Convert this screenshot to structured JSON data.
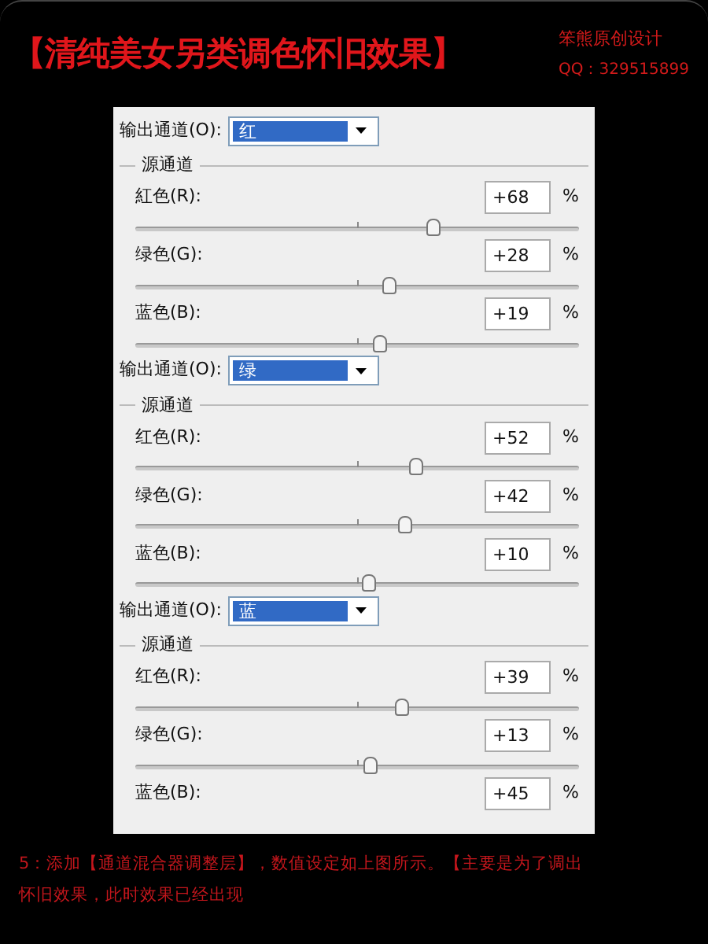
{
  "header": {
    "title": "【清纯美女另类调色怀旧效果】",
    "credit": "笨熊原创设计",
    "qq": "QQ：329515899"
  },
  "sections": [
    {
      "output_label": "输出通道(O):",
      "output_value": "红",
      "group_label": "源通道",
      "channels": [
        {
          "label": "紅色(R):",
          "value": "+68",
          "unit": "%",
          "level": 0.67
        },
        {
          "label": "绿色(G):",
          "value": "+28",
          "unit": "%",
          "level": 0.57
        },
        {
          "label": "蓝色(B):",
          "value": "+19",
          "unit": "%",
          "level": 0.55
        }
      ]
    },
    {
      "output_label": "输出通道(O):",
      "output_value": "绿",
      "group_label": "源通道",
      "channels": [
        {
          "label": "红色(R):",
          "value": "+52",
          "unit": "%",
          "level": 0.63
        },
        {
          "label": "绿色(G):",
          "value": "+42",
          "unit": "%",
          "level": 0.605
        },
        {
          "label": "蓝色(B):",
          "value": "+10",
          "unit": "%",
          "level": 0.525
        }
      ]
    },
    {
      "output_label": "输出通道(O):",
      "output_value": "蓝",
      "group_label": "源通道",
      "channels": [
        {
          "label": "红色(R):",
          "value": "+39",
          "unit": "%",
          "level": 0.6
        },
        {
          "label": "绿色(G):",
          "value": "+13",
          "unit": "%",
          "level": 0.53
        },
        {
          "label": "蓝色(B):",
          "value": "+45",
          "unit": "%"
        }
      ]
    }
  ],
  "caption": [
    "5：添加【通道混合器调整层】，数值设定如上图所示。【主要是为了调出",
    "怀旧效果，此时效果已经出现"
  ]
}
